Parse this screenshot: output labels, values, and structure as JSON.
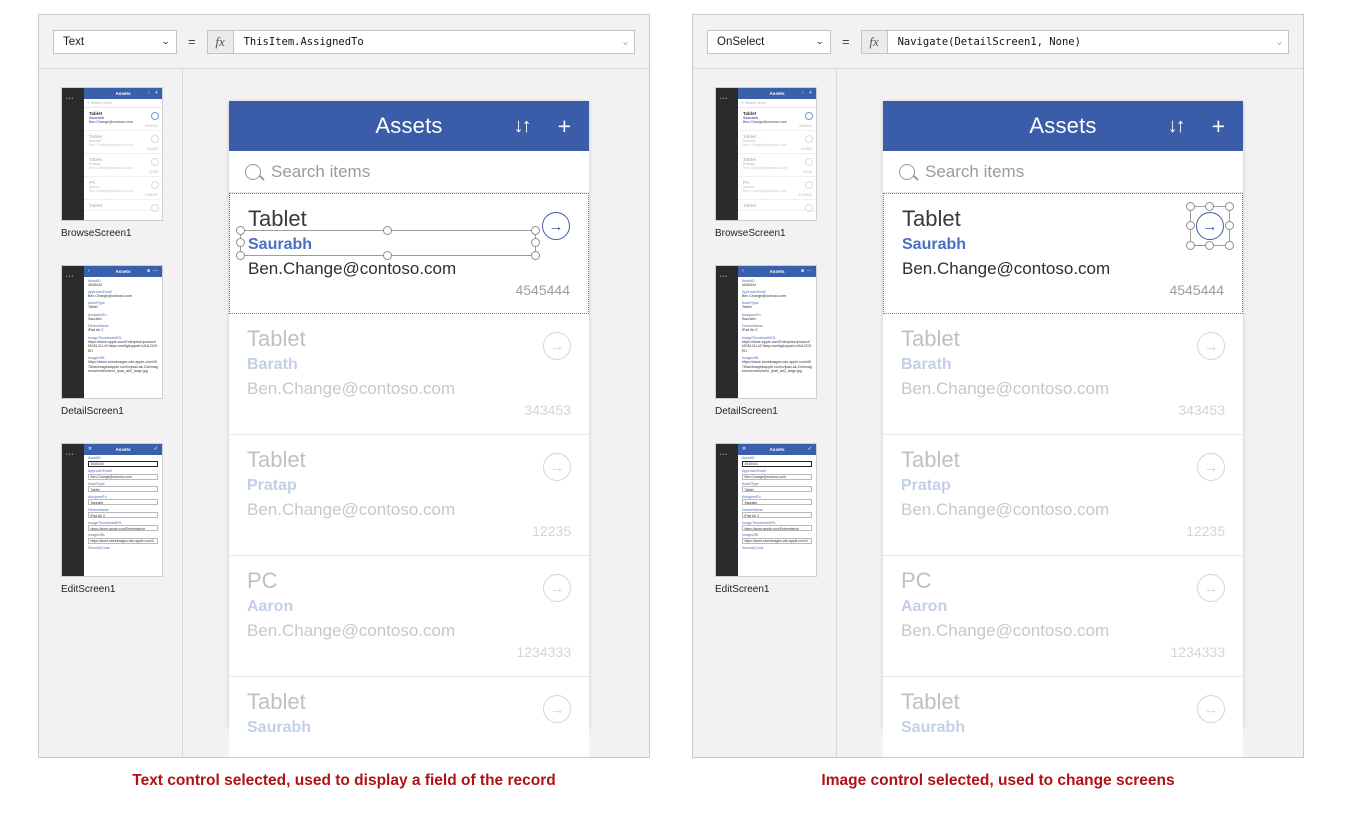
{
  "panels": [
    {
      "id": "left",
      "formula": {
        "property": "Text",
        "equals": "=",
        "fx": "fx",
        "expression": "ThisItem.AssignedTo",
        "chevron": "⌄"
      },
      "caption": "Text control selected, used to display a field of the record"
    },
    {
      "id": "right",
      "formula": {
        "property": "OnSelect",
        "equals": "=",
        "fx": "fx",
        "expression": "Navigate(DetailScreen1, None)",
        "chevron": "⌄"
      },
      "caption": "Image control selected, used to change screens"
    }
  ],
  "screens": [
    {
      "label": "BrowseScreen1",
      "kind": "browse"
    },
    {
      "label": "DetailScreen1",
      "kind": "detail"
    },
    {
      "label": "EditScreen1",
      "kind": "edit"
    }
  ],
  "thumbnail": {
    "header_title": "Assets",
    "search_text": "Search items",
    "dots": "•••",
    "browse_icons": {
      "sort": "↕",
      "add": "+"
    },
    "detail_icons": {
      "back": "‹",
      "edit": "■",
      "more": "⋯"
    },
    "edit_icons": {
      "cancel": "✕",
      "accept": "✓"
    },
    "rows": [
      {
        "title": "Tablet",
        "sub": "Saurabh",
        "mail": "Ben.Change@contoso.com",
        "num": "4545444"
      },
      {
        "title": "Tablet",
        "sub": "Barath",
        "mail": "Ben.Change@contoso.com",
        "num": "343453"
      },
      {
        "title": "Tablet",
        "sub": "Pratap",
        "mail": "Ben.Change@contoso.com",
        "num": "12235"
      },
      {
        "title": "PC",
        "sub": "Aaron",
        "mail": "Ben.Change@contoso.com",
        "num": "1234333"
      },
      {
        "title": "Tablet",
        "sub": "Saurabh",
        "mail": "",
        "num": ""
      }
    ],
    "detail_fields": [
      {
        "label": "AssetID",
        "value": "4545444"
      },
      {
        "label": "ApproverEmail",
        "value": "Ben.Change@contoso.com"
      },
      {
        "label": "AssetType",
        "value": "Tablet"
      },
      {
        "label": "AssignedTo",
        "value": "Saurabh"
      },
      {
        "label": "DeviceName",
        "value": "iPad Air 2"
      },
      {
        "label": "ImageThumbnailURL",
        "value": "https://store.apple.com/Enterprise/product/MGKL2LL/A?step=config&cppart=UNLOCKED"
      },
      {
        "label": "ImageURL",
        "value": "https://store.storeimages.cdn-apple.com/4976/as/images/apple.com/v/ipad-air-2/a/images/overview/hero_ipad_air2_large.jpg"
      }
    ],
    "edit_fields": [
      {
        "label": "AssetID",
        "value": "4545444",
        "focused": true
      },
      {
        "label": "ApproverEmail",
        "value": "Ben.Change@contoso.com",
        "focused": false
      },
      {
        "label": "AssetType",
        "value": "Tablet",
        "focused": false
      },
      {
        "label": "AssignedTo",
        "value": "Saurabh",
        "focused": false
      },
      {
        "label": "DeviceName",
        "value": "iPad Air 2",
        "focused": false
      },
      {
        "label": "ImageThumbnailURL",
        "value": "https://store.apple.com/Enterprise/pr",
        "focused": false
      },
      {
        "label": "ImageURL",
        "value": "https://store.storeimages.cdn-apple.com/4",
        "focused": false
      },
      {
        "label": "SecurityCode",
        "value": "",
        "focused": false
      }
    ]
  },
  "phone": {
    "header": {
      "title": "Assets",
      "sort_icon": "↓↑",
      "add_icon": "+"
    },
    "search": {
      "placeholder": "Search items",
      "icon": "search-icon"
    },
    "rows": [
      {
        "title": "Tablet",
        "assigned_to": "Saurabh",
        "email": "Ben.Change@contoso.com",
        "number": "4545444",
        "arrow": "→",
        "selected": true
      },
      {
        "title": "Tablet",
        "assigned_to": "Barath",
        "email": "Ben.Change@contoso.com",
        "number": "343453",
        "arrow": "→",
        "selected": false
      },
      {
        "title": "Tablet",
        "assigned_to": "Pratap",
        "email": "Ben.Change@contoso.com",
        "number": "12235",
        "arrow": "→",
        "selected": false
      },
      {
        "title": "PC",
        "assigned_to": "Aaron",
        "email": "Ben.Change@contoso.com",
        "number": "1234333",
        "arrow": "→",
        "selected": false
      },
      {
        "title": "Tablet",
        "assigned_to": "Saurabh",
        "email": "",
        "number": "",
        "arrow": "→",
        "selected": false
      }
    ]
  },
  "colors": {
    "brand_blue": "#3b5ca8",
    "accent_link": "#4a6fc0",
    "caption_red": "#b01116",
    "canvas_gray": "#f2f2f2"
  }
}
